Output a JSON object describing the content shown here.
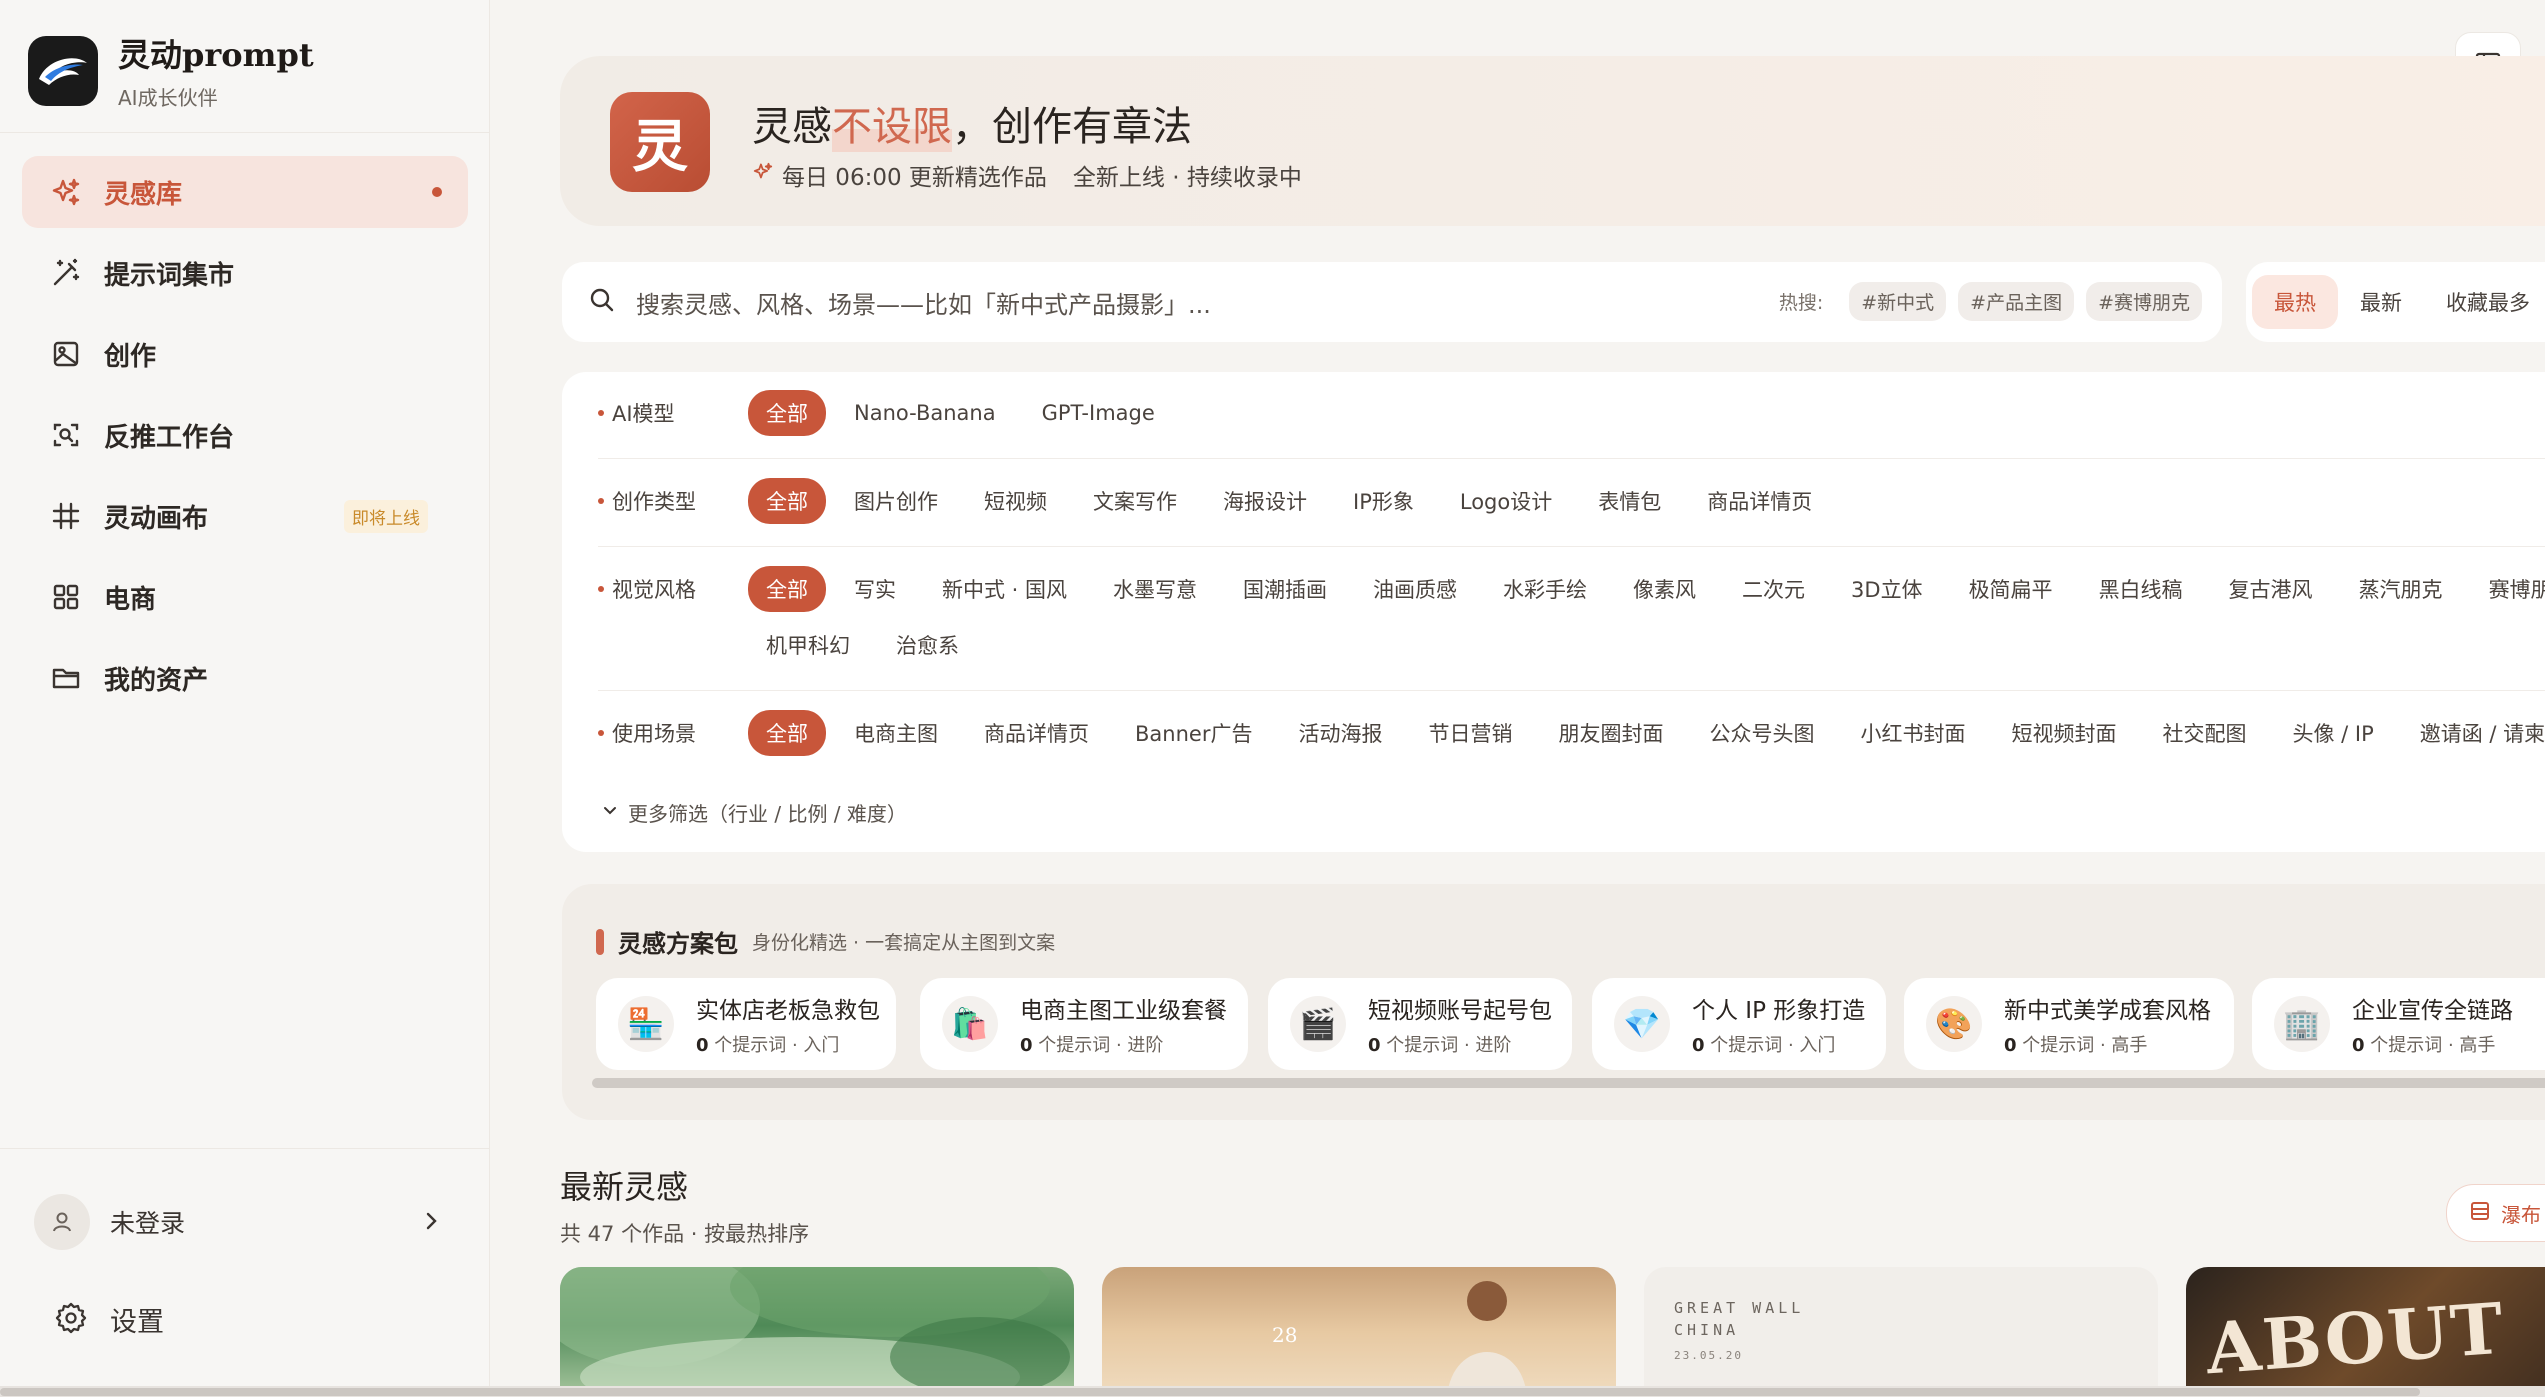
{
  "brand": {
    "title": "灵动prompt",
    "subtitle": "AI成长伙伴"
  },
  "nav": {
    "items": [
      {
        "label": "灵感库",
        "icon": "sparkles-icon",
        "active": true
      },
      {
        "label": "提示词集市",
        "icon": "magic-wand-icon"
      },
      {
        "label": "创作",
        "icon": "image-icon"
      },
      {
        "label": "反推工作台",
        "icon": "scan-search-icon"
      },
      {
        "label": "灵动画布",
        "icon": "hash-grid-icon",
        "badge": "即将上线"
      },
      {
        "label": "电商",
        "icon": "grid-apps-icon"
      },
      {
        "label": "我的资产",
        "icon": "folder-icon"
      }
    ]
  },
  "user": {
    "name": "未登录",
    "icon": "user-icon"
  },
  "settings": {
    "label": "设置",
    "icon": "gear-icon"
  },
  "hero": {
    "mark": "灵",
    "title_part1": "灵感",
    "title_accent": "不设限",
    "title_part2": "，创作有章法",
    "sub1": "每日 06:00 更新精选作品",
    "sub2": "全新上线 · 持续收录中"
  },
  "search": {
    "placeholder": "搜索灵感、风格、场景——比如「新中式产品摄影」...",
    "hot_label": "热搜:",
    "hot_tags": [
      "#新中式",
      "#产品主图",
      "#赛博朋克"
    ]
  },
  "sort": {
    "items": [
      "最热",
      "最新",
      "收藏最多"
    ],
    "active": "最热"
  },
  "filters": {
    "model": {
      "label": "AI模型",
      "options": [
        "全部",
        "Nano-Banana",
        "GPT-Image"
      ]
    },
    "type": {
      "label": "创作类型",
      "options": [
        "全部",
        "图片创作",
        "短视频",
        "文案写作",
        "海报设计",
        "IP形象",
        "Logo设计",
        "表情包",
        "商品详情页"
      ]
    },
    "style": {
      "label": "视觉风格",
      "options": [
        "全部",
        "写实",
        "新中式 · 国风",
        "水墨写意",
        "国潮插画",
        "油画质感",
        "水彩手绘",
        "像素风",
        "二次元",
        "3D立体",
        "极简扁平",
        "黑白线稿",
        "复古港风",
        "蒸汽朋克",
        "赛博朋"
      ],
      "options_row2": [
        "机甲科幻",
        "治愈系"
      ]
    },
    "scene": {
      "label": "使用场景",
      "options": [
        "全部",
        "电商主图",
        "商品详情页",
        "Banner广告",
        "活动海报",
        "节日营销",
        "朋友圈封面",
        "公众号头图",
        "小红书封面",
        "短视频封面",
        "社交配图",
        "头像 / IP",
        "邀请函 / 请柬"
      ]
    },
    "more": "更多筛选（行业 / 比例 / 难度）"
  },
  "packs": {
    "title": "灵感方案包",
    "subtitle": "身份化精选 · 一套搞定从主图到文案",
    "items": [
      {
        "title": "实体店老板急救包",
        "count": "0",
        "meta": " 个提示词 · 入门",
        "icon": "🏪"
      },
      {
        "title": "电商主图工业级套餐",
        "count": "0",
        "meta": " 个提示词 · 进阶",
        "icon": "🛍️"
      },
      {
        "title": "短视频账号起号包",
        "count": "0",
        "meta": " 个提示词 · 进阶",
        "icon": "🎬"
      },
      {
        "title": "个人 IP 形象打造",
        "count": "0",
        "meta": " 个提示词 · 入门",
        "icon": "💎"
      },
      {
        "title": "新中式美学成套风格",
        "count": "0",
        "meta": " 个提示词 · 高手",
        "icon": "🎨"
      },
      {
        "title": "企业宣传全链路",
        "count": "0",
        "meta": " 个提示词 · 高手",
        "icon": "🏢"
      }
    ]
  },
  "latest": {
    "title": "最新灵感",
    "subtitle": "共 47 个作品 · 按最热排序",
    "view_toggle": "瀑布"
  },
  "thumbs": {
    "t2_num": "28",
    "t3_line1": "GREAT WALL",
    "t3_line2": "CHINA",
    "t3_date": "23.05.20",
    "t4_text": "ABOUT"
  },
  "colors": {
    "accent": "#c8563a",
    "accent_light": "#f7e4de"
  }
}
